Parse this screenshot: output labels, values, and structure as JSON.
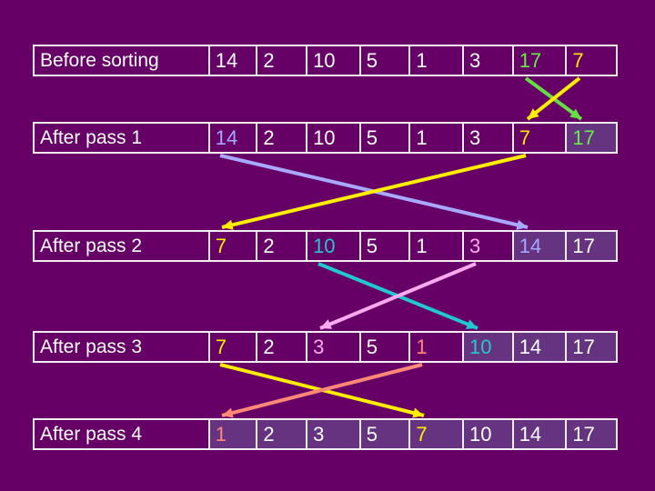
{
  "colors": {
    "background": "#660066",
    "shaded_cell": "#663380",
    "border": "#f4eef4"
  },
  "rows": [
    {
      "label": "Before sorting",
      "values": [
        "14",
        "2",
        "10",
        "5",
        "1",
        "3",
        "17",
        "7"
      ],
      "colors": [
        null,
        null,
        null,
        null,
        null,
        null,
        "#66ee44",
        "#ffee00"
      ],
      "sorted_from": 8
    },
    {
      "label": "After pass 1",
      "values": [
        "14",
        "2",
        "10",
        "5",
        "1",
        "3",
        "7",
        "17"
      ],
      "colors": [
        "#a8a8ff",
        null,
        null,
        null,
        null,
        null,
        "#ffee00",
        "#66ee44"
      ],
      "sorted_from": 7
    },
    {
      "label": "After pass 2",
      "values": [
        "7",
        "2",
        "10",
        "5",
        "1",
        "3",
        "14",
        "17"
      ],
      "colors": [
        "#ffee00",
        null,
        "#22c8d0",
        null,
        null,
        "#ffaaee",
        "#a8a8ff",
        null
      ],
      "sorted_from": 6
    },
    {
      "label": "After pass 3",
      "values": [
        "7",
        "2",
        "3",
        "5",
        "1",
        "10",
        "14",
        "17"
      ],
      "colors": [
        "#ffee00",
        null,
        "#ffaaee",
        null,
        "#ff8877",
        "#22c8d0",
        null,
        null
      ],
      "sorted_from": 5
    },
    {
      "label": "After pass 4",
      "values": [
        "1",
        "2",
        "3",
        "5",
        "7",
        "10",
        "14",
        "17"
      ],
      "colors": [
        "#ff8877",
        null,
        null,
        null,
        "#ffee00",
        null,
        null,
        null
      ],
      "sorted_from": 0
    }
  ],
  "swaps": [
    {
      "from_row": 0,
      "from_col": 6,
      "to_row": 1,
      "to_col": 7,
      "color": "#66dd44"
    },
    {
      "from_row": 0,
      "from_col": 7,
      "to_row": 1,
      "to_col": 6,
      "color": "#ffee00"
    },
    {
      "from_row": 1,
      "from_col": 0,
      "to_row": 2,
      "to_col": 6,
      "color": "#a8a8ff"
    },
    {
      "from_row": 1,
      "from_col": 6,
      "to_row": 2,
      "to_col": 0,
      "color": "#ffee00"
    },
    {
      "from_row": 2,
      "from_col": 2,
      "to_row": 3,
      "to_col": 5,
      "color": "#22c8d0"
    },
    {
      "from_row": 2,
      "from_col": 5,
      "to_row": 3,
      "to_col": 2,
      "color": "#ffaaee"
    },
    {
      "from_row": 3,
      "from_col": 0,
      "to_row": 4,
      "to_col": 4,
      "color": "#ffee00"
    },
    {
      "from_row": 3,
      "from_col": 4,
      "to_row": 4,
      "to_col": 0,
      "color": "#ff8877"
    }
  ]
}
